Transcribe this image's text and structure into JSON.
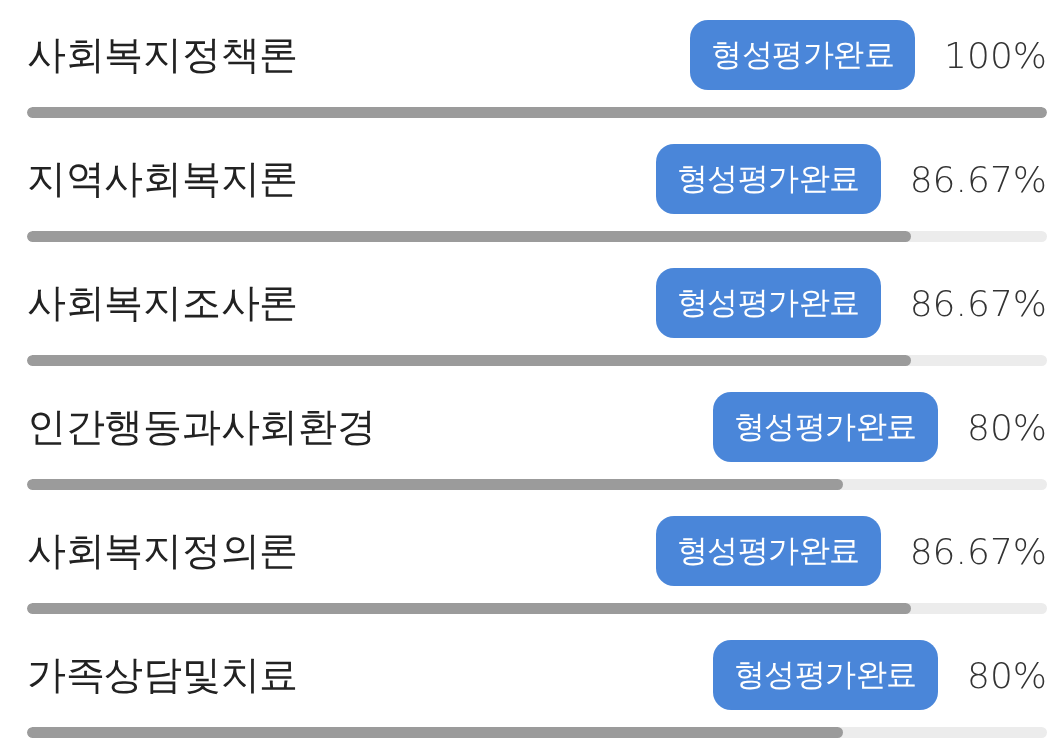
{
  "courses": [
    {
      "title": "사회복지정책론",
      "badge": "형성평가완료",
      "percent": "100%",
      "level": 1.0
    },
    {
      "title": "지역사회복지론",
      "badge": "형성평가완료",
      "percent": "86.67%",
      "level": 0.8667
    },
    {
      "title": "사회복지조사론",
      "badge": "형성평가완료",
      "percent": "86.67%",
      "level": 0.8667
    },
    {
      "title": "인간행동과사회환경",
      "badge": "형성평가완료",
      "percent": "80%",
      "level": 0.8
    },
    {
      "title": "사회복지정의론",
      "badge": "형성평가완료",
      "percent": "86.67%",
      "level": 0.8667
    },
    {
      "title": "가족상담및치료",
      "badge": "형성평가완료",
      "percent": "80%",
      "level": 0.8
    }
  ]
}
